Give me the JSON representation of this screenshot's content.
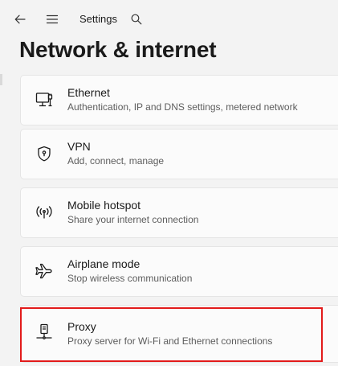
{
  "window": {
    "app_title": "Settings",
    "back_icon": "back-arrow-icon",
    "menu_icon": "hamburger-menu-icon",
    "search_icon": "search-icon"
  },
  "page": {
    "title": "Network & internet"
  },
  "items": [
    {
      "icon": "ethernet-icon",
      "title": "Ethernet",
      "subtitle": "Authentication, IP and DNS settings, metered network"
    },
    {
      "icon": "vpn-shield-icon",
      "title": "VPN",
      "subtitle": "Add, connect, manage"
    },
    {
      "icon": "mobile-hotspot-icon",
      "title": "Mobile hotspot",
      "subtitle": "Share your internet connection"
    },
    {
      "icon": "airplane-icon",
      "title": "Airplane mode",
      "subtitle": "Stop wireless communication"
    },
    {
      "icon": "proxy-icon",
      "title": "Proxy",
      "subtitle": "Proxy server for Wi-Fi and Ethernet connections"
    }
  ],
  "highlight_color": "#e21b1b"
}
